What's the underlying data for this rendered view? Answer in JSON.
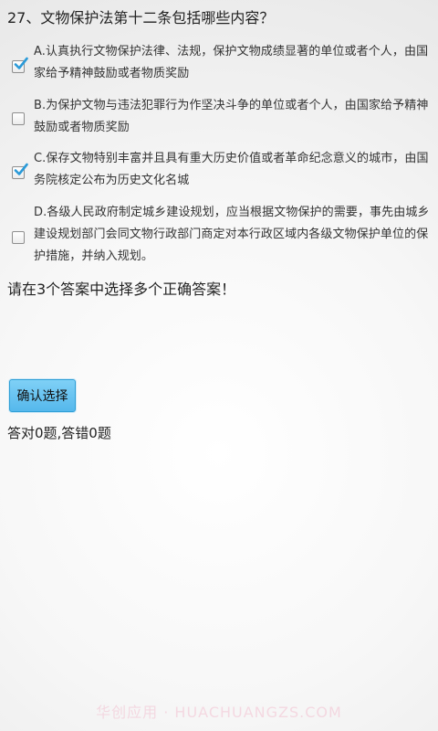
{
  "question": {
    "text": "27、文物保护法第十二条包括哪些内容？"
  },
  "options": [
    {
      "label": "A.认真执行文物保护法律、法规，保护文物成绩显著的单位或者个人，由国家给予精神鼓励或者物质奖励",
      "checked": true
    },
    {
      "label": "B.为保护文物与违法犯罪行为作坚决斗争的单位或者个人，由国家给予精神鼓励或者物质奖励",
      "checked": false
    },
    {
      "label": "C.保存文物特别丰富并且具有重大历史价值或者革命纪念意义的城市，由国务院核定公布为历史文化名城",
      "checked": true
    },
    {
      "label": "D.各级人民政府制定城乡建设规划，应当根据文物保护的需要，事先由城乡建设规划部门会同文物行政部门商定对本行政区域内各级文物保护单位的保护措施，并纳入规划。",
      "checked": false
    }
  ],
  "hint": {
    "text": "请在3个答案中选择多个正确答案！"
  },
  "confirm": {
    "label": "确认选择"
  },
  "score": {
    "text": "答对0题,答错0题"
  },
  "watermark": {
    "text": "华创应用 · HUACHUANGZS.COM"
  },
  "colors": {
    "button_fill": "#6cc6f2",
    "button_border": "#2f9fd6",
    "check_mark": "#2a9ad8"
  }
}
